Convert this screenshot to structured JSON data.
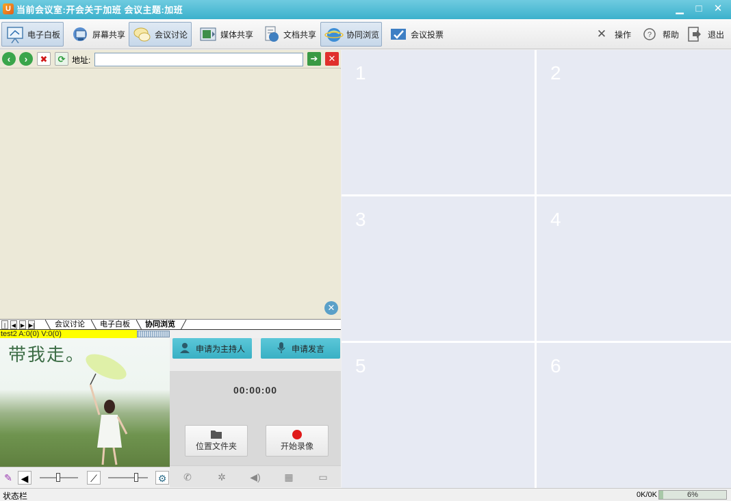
{
  "window": {
    "title": "当前会议室:开会关于加班 会议主题:加班",
    "minimize": "▁",
    "maximize": "□",
    "close": "✕",
    "app_icon_letter": "U"
  },
  "toolbar": {
    "items": [
      {
        "label": "电子白板",
        "icon": "whiteboard-icon",
        "active": true
      },
      {
        "label": "屏幕共享",
        "icon": "screen-share-icon",
        "active": false
      },
      {
        "label": "会议讨论",
        "icon": "discussion-icon",
        "active": true
      },
      {
        "label": "媒体共享",
        "icon": "media-share-icon",
        "active": false
      },
      {
        "label": "文档共享",
        "icon": "document-share-icon",
        "active": false
      },
      {
        "label": "协同浏览",
        "icon": "co-browse-icon",
        "active": true
      },
      {
        "label": "会议投票",
        "icon": "vote-icon",
        "active": false
      }
    ],
    "right": [
      {
        "label": "操作",
        "icon": "tools-icon"
      },
      {
        "label": "帮助",
        "icon": "help-icon"
      },
      {
        "label": "退出",
        "icon": "exit-icon"
      }
    ]
  },
  "browser": {
    "address_label": "地址:",
    "address_value": "",
    "go_glyph": "➔",
    "close_glyph": "✕"
  },
  "tabs": {
    "items": [
      {
        "label": "会议讨论",
        "active": false
      },
      {
        "label": "电子白板",
        "active": false
      },
      {
        "label": "协同浏览",
        "active": true
      }
    ]
  },
  "user_strip": "test2 A:0(0) V:0(0)",
  "video": {
    "caption": "带我走。"
  },
  "video_controls": {
    "speaker_value": "0",
    "mic_value": "0"
  },
  "panel": {
    "apply_host": "申请为主持人",
    "apply_speak": "申请发言",
    "timer": "00:00:00",
    "folder": "位置文件夹",
    "record": "开始录像"
  },
  "grid": {
    "cells": [
      "1",
      "2",
      "3",
      "4",
      "5",
      "6"
    ]
  },
  "statusbar": {
    "label": "状态栏",
    "net_rate": "0K/0K",
    "progress_text": "6%",
    "progress_value": 0.06
  },
  "colors": {
    "titlebar": "#3bb1cc",
    "accent": "#39b0c4",
    "grid_cell": "#e7eaf3",
    "record_red": "#e01a1a"
  }
}
